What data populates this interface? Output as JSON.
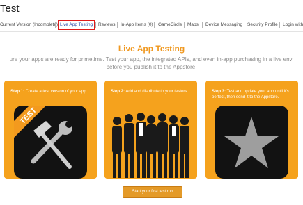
{
  "app": {
    "title": "Test"
  },
  "tabs": [
    {
      "label": "Current Version (Incomplete)"
    },
    {
      "label": "Live App Testing",
      "active": true
    },
    {
      "label": "Reviews"
    },
    {
      "label": "In-App Items (0)"
    },
    {
      "label": "GameCircle"
    },
    {
      "label": "Maps"
    },
    {
      "label": "Device Messaging"
    },
    {
      "label": "Security Profile"
    },
    {
      "label": "Login with A"
    }
  ],
  "hero": {
    "title": "Live App Testing",
    "line1": "ure your apps are ready for primetime. Test your app, the integrated APIs, and even in-app purchasing in a live envi",
    "line2": "before you publish it to the Appstore."
  },
  "steps": [
    {
      "step": "Step 1:",
      "text": "Create a test version of your app.",
      "icon": "test-tools-icon",
      "badge": "TEST"
    },
    {
      "step": "Step 2:",
      "text": "Add and distribute to your testers.",
      "icon": "testers-group-icon"
    },
    {
      "step": "Step 3:",
      "text": "Test and update your app until it's perfect, then send it to the Appstore.",
      "icon": "star-app-icon"
    }
  ],
  "cta": {
    "label": "Start your first test run"
  },
  "colors": {
    "accent": "#f5a21d",
    "title": "#f0981f",
    "active_tab_border": "#e01b1b",
    "link": "#2a4aa8"
  }
}
